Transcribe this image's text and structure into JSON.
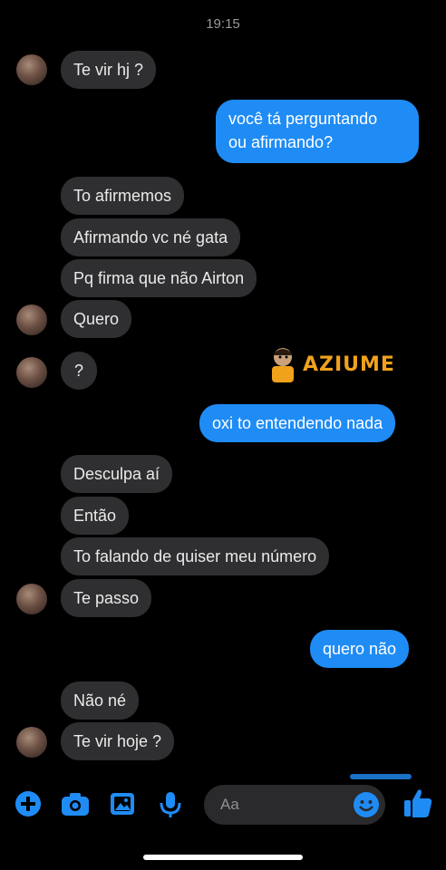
{
  "status_bar": {
    "time": "19:15"
  },
  "messages": [
    {
      "text": "Te vir hj ?"
    },
    {
      "text": "você tá perguntando"
    },
    {
      "text": "ou afirmando?"
    },
    {
      "text": "To afirmemos"
    },
    {
      "text": "Afirmando vc né gata"
    },
    {
      "text": "Pq firma que não Airton"
    },
    {
      "text": "Quero"
    },
    {
      "text": "?"
    },
    {
      "text": "oxi to entendendo nada"
    },
    {
      "text": "Desculpa aí"
    },
    {
      "text": "Então"
    },
    {
      "text": "To falando de quiser meu número"
    },
    {
      "text": "Te passo"
    },
    {
      "text": "quero não"
    },
    {
      "text": "Não né"
    },
    {
      "text": "Te vir hoje ?"
    }
  ],
  "watermark": {
    "text": "AZIUME"
  },
  "composer": {
    "placeholder": "Aa",
    "icons": [
      "plus-icon",
      "camera-icon",
      "gallery-icon",
      "microphone-icon",
      "emoji-icon",
      "thumbs-up-icon"
    ],
    "accent_color": "#1f8cf5"
  },
  "colors": {
    "incoming_bubble": "#2f2f31",
    "outgoing_bubble": "#1f8cf5",
    "background": "#000000"
  }
}
